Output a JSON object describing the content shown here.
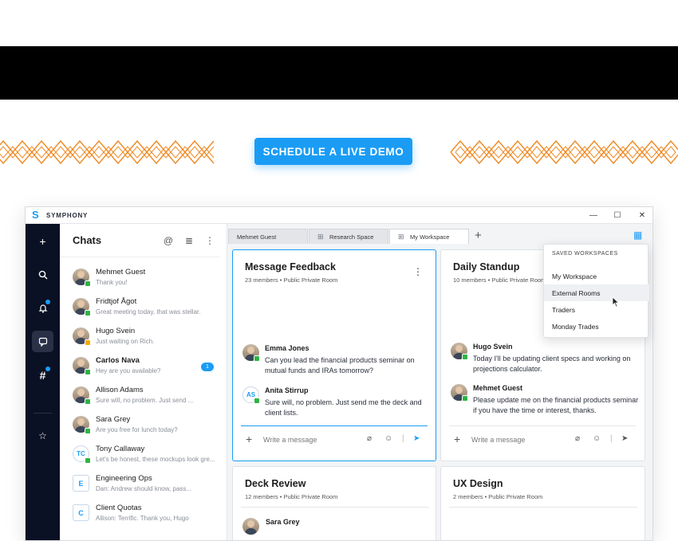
{
  "cta": {
    "label": "SCHEDULE A LIVE DEMO"
  },
  "app": {
    "name": "SYMPHONY"
  },
  "window_controls": {
    "minimize": "—",
    "maximize": "☐",
    "close": "✕"
  },
  "chats": {
    "title": "Chats",
    "items": [
      {
        "name": "Mehmet Guest",
        "preview": "Thank you!",
        "avatar": "photo",
        "presence": "online",
        "bold": false
      },
      {
        "name": "Fridtjof Ågot",
        "preview": "Great meeting today, that was stellar.",
        "avatar": "photo",
        "presence": "online",
        "bold": false
      },
      {
        "name": "Hugo Svein",
        "preview": "Just waiting on Rich.",
        "avatar": "photo",
        "presence": "away",
        "bold": false
      },
      {
        "name": "Carlos Nava",
        "preview": "Hey are you available?",
        "avatar": "photo",
        "presence": "online",
        "bold": true,
        "badge": "1"
      },
      {
        "name": "Allison Adams",
        "preview": "Sure will, no problem. Just send ...",
        "avatar": "photo",
        "presence": "online",
        "bold": false
      },
      {
        "name": "Sara Grey",
        "preview": "Are you free for lunch today?",
        "avatar": "photo",
        "presence": "online",
        "bold": false
      },
      {
        "name": "Tony Callaway",
        "preview": "Let's be honest, these mockups look gre...",
        "avatar": "TC",
        "presence": "online",
        "bold": false
      },
      {
        "name": "Engineering Ops",
        "preview": "Dan: Andrew should know, pass...",
        "avatar": "E",
        "presence": "none",
        "bold": false
      },
      {
        "name": "Client Quotas",
        "preview": "Allison: Terrific. Thank you, Hugo",
        "avatar": "C",
        "presence": "none",
        "bold": false
      }
    ]
  },
  "tabs": [
    {
      "label": "Mehmet Guest",
      "icon": false,
      "active": false
    },
    {
      "label": "Research Space",
      "icon": true,
      "active": false
    },
    {
      "label": "My Workspace",
      "icon": true,
      "active": true
    }
  ],
  "cards": {
    "feedback": {
      "title": "Message Feedback",
      "subtitle": "23 members  •  Public Private Room",
      "messages": [
        {
          "author": "Emma Jones",
          "text": "Can you lead the financial products seminar on mutual funds and IRAs tomorrow?",
          "avatar": "photo"
        },
        {
          "author": "Anita Stirrup",
          "text": "Sure will, no problem. Just send me the deck and client lists.",
          "avatar": "AS"
        }
      ],
      "placeholder": "Write a message"
    },
    "standup": {
      "title": "Daily Standup",
      "subtitle": "10 members  •  Public Private Room",
      "messages": [
        {
          "author": "Hugo Svein",
          "text": "Today I'll be updating client specs and working on projections calculator."
        },
        {
          "author": "Mehmet Guest",
          "text": "Please update me on the financial products seminar if you have the time or interest, thanks."
        }
      ],
      "placeholder": "Write a message"
    },
    "deck": {
      "title": "Deck Review",
      "subtitle": "12 members  •  Public Private Room",
      "first_author": "Sara Grey"
    },
    "ux": {
      "title": "UX Design",
      "subtitle": "2 members  •  Public Private Room"
    }
  },
  "workspaces": {
    "header": "SAVED WORKSPACES",
    "items": [
      "My Workspace",
      "External Rooms",
      "Traders",
      "Monday Trades"
    ],
    "hovered": "External Rooms"
  },
  "colors": {
    "accent": "#1a9cf5",
    "rail": "#0b1124",
    "zigzag": "#f08a24",
    "online": "#2fb344",
    "away": "#f2a900"
  }
}
